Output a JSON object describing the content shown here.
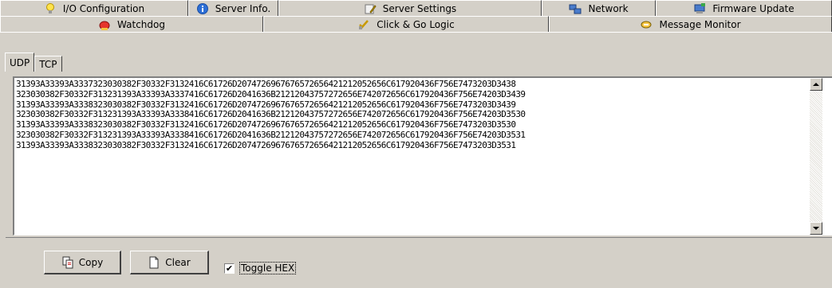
{
  "tabs_row1": [
    {
      "label": "I/O Configuration",
      "icon": "bulb-icon"
    },
    {
      "label": "Server Info.",
      "icon": "info-icon"
    },
    {
      "label": "Server Settings",
      "icon": "settings-icon"
    },
    {
      "label": "Network",
      "icon": "network-icon"
    },
    {
      "label": "Firmware Update",
      "icon": "firmware-icon"
    }
  ],
  "tabs_row2": [
    {
      "label": "Watchdog",
      "icon": "watchdog-icon"
    },
    {
      "label": "Click & Go Logic",
      "icon": "logic-icon"
    },
    {
      "label": "Message Monitor",
      "icon": "monitor-icon",
      "active": true
    }
  ],
  "subtabs": [
    {
      "label": "UDP",
      "active": true
    },
    {
      "label": "TCP",
      "active": false
    }
  ],
  "hex_lines": [
    "31393A33393A3337323030382F30332F3132416C61726D2074726967676572656421212052656C617920436F756E7473203D3438",
    "323030382F30332F313231393A33393A3337416C61726D2041636B21212043757272656E742072656C617920436F756E74203D3439",
    "31393A33393A3338323030382F30332F3132416C61726D2074726967676572656421212052656C617920436F756E7473203D3439",
    "323030382F30332F313231393A33393A3338416C61726D2041636B21212043757272656E742072656C617920436F756E74203D3530",
    "31393A33393A3338323030382F30332F3132416C61726D2074726967676572656421212052656C617920436F756E7473203D3530",
    "323030382F30332F313231393A33393A3338416C61726D2041636B21212043757272656E742072656C617920436F756E74203D3531",
    "31393A33393A3338323030382F30332F3132416C61726D2074726967676572656421212052656C617920436F756E7473203D3531"
  ],
  "buttons": {
    "copy_label": "Copy",
    "clear_label": "Clear"
  },
  "toggle_hex": {
    "label": "Toggle HEX",
    "checked": true,
    "check_glyph": "✔"
  }
}
